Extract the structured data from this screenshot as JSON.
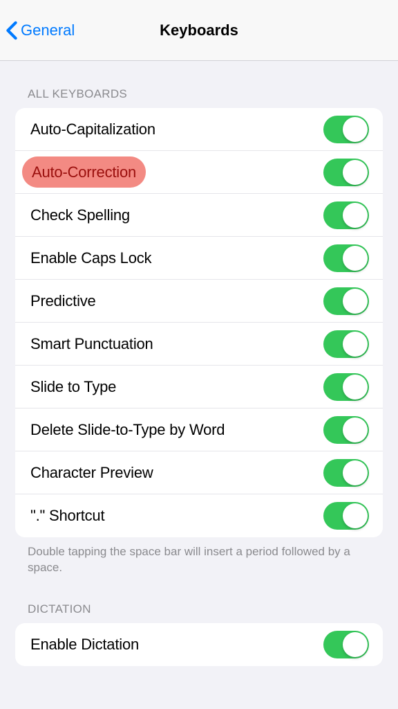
{
  "nav": {
    "back_label": "General",
    "title": "Keyboards"
  },
  "sections": {
    "all_keyboards": {
      "header": "ALL KEYBOARDS",
      "items": [
        {
          "label": "Auto-Capitalization",
          "on": true,
          "highlighted": false
        },
        {
          "label": "Auto-Correction",
          "on": true,
          "highlighted": true
        },
        {
          "label": "Check Spelling",
          "on": true,
          "highlighted": false
        },
        {
          "label": "Enable Caps Lock",
          "on": true,
          "highlighted": false
        },
        {
          "label": "Predictive",
          "on": true,
          "highlighted": false
        },
        {
          "label": "Smart Punctuation",
          "on": true,
          "highlighted": false
        },
        {
          "label": "Slide to Type",
          "on": true,
          "highlighted": false
        },
        {
          "label": "Delete Slide-to-Type by Word",
          "on": true,
          "highlighted": false
        },
        {
          "label": "Character Preview",
          "on": true,
          "highlighted": false
        },
        {
          "label": "\".\" Shortcut",
          "on": true,
          "highlighted": false
        }
      ],
      "footer": "Double tapping the space bar will insert a period followed by a space."
    },
    "dictation": {
      "header": "DICTATION",
      "items": [
        {
          "label": "Enable Dictation",
          "on": true,
          "highlighted": false
        }
      ]
    }
  }
}
